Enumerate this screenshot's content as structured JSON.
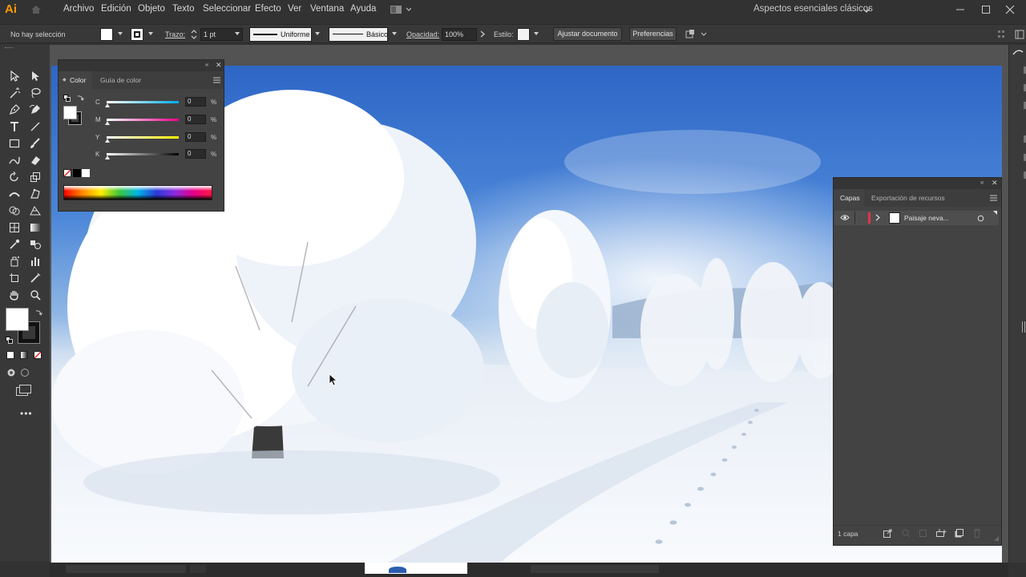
{
  "app": {
    "logo": "Ai",
    "menu": [
      "Archivo",
      "Edición",
      "Objeto",
      "Texto",
      "Seleccionar",
      "Efecto",
      "Ver",
      "Ventana",
      "Ayuda"
    ],
    "workspace": "Aspectos esenciales clásicos"
  },
  "control_bar": {
    "selection": "No hay selección",
    "stroke_label": "Trazo:",
    "stroke_weight": "1 pt",
    "profile": "Uniforme",
    "brush": "Básico",
    "opacity_label": "Opacidad:",
    "opacity_value": "100%",
    "style_label": "Estilo:",
    "document_setup": "Ajustar documento",
    "preferences": "Preferencias"
  },
  "color_panel": {
    "tabs": [
      "Color",
      "Guía de color"
    ],
    "sliders": [
      {
        "label": "C",
        "value": "0",
        "unit": "%"
      },
      {
        "label": "M",
        "value": "0",
        "unit": "%"
      },
      {
        "label": "Y",
        "value": "0",
        "unit": "%"
      },
      {
        "label": "K",
        "value": "0",
        "unit": "%"
      }
    ]
  },
  "layers_panel": {
    "tabs": [
      "Capas",
      "Exportación de recursos"
    ],
    "layer_name": "Paisaje neva...",
    "layer_count": "1 capa",
    "layer_color": "#e5334b"
  },
  "colors": {
    "ui_dark": "#323232",
    "panel": "#434343",
    "accent_orange": "#ff9a00"
  }
}
